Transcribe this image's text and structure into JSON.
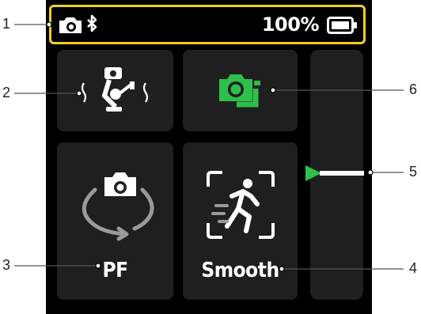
{
  "status_bar": {
    "battery_percent_text": "100%",
    "icons": [
      "camera-bluetooth-icon",
      "battery-full-icon"
    ]
  },
  "tiles": {
    "gimbal_mode": {
      "icon": "gimbal-icon"
    },
    "camera_control": {
      "icon": "camera-green-icon",
      "accent": "#2fbf4b"
    },
    "mode": {
      "label": "PF",
      "icon": "rotate-camera-icon"
    },
    "motion": {
      "label": "Smooth",
      "icon": "running-person-frame-icon"
    }
  },
  "slider": {
    "indicator_color": "#2fbf4b",
    "level": 0.55
  },
  "callouts": [
    "1",
    "2",
    "3",
    "4",
    "5",
    "6"
  ],
  "colors": {
    "status_highlight": "#f2cf22",
    "tile_bg": "#1f1f1f",
    "screen_bg": "#000000"
  }
}
